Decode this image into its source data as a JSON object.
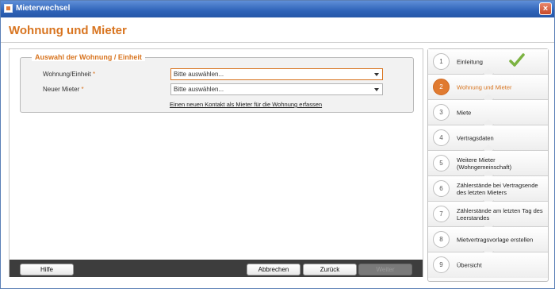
{
  "window": {
    "title": "Mieterwechsel",
    "close_glyph": "×"
  },
  "page": {
    "heading": "Wohnung und Mieter"
  },
  "form": {
    "legend": "Auswahl der Wohnung / Einheit",
    "unit": {
      "label": "Wohnung/Einheit",
      "required": "*",
      "value": "Bitte auswählen..."
    },
    "tenant": {
      "label": "Neuer Mieter",
      "required": "*",
      "value": "Bitte auswählen..."
    },
    "new_contact_link": "Einen neuen Kontakt als Mieter für die Wohnung erfassen"
  },
  "footer": {
    "help": "Hilfe",
    "cancel": "Abbrechen",
    "back": "Zurück",
    "next": "Weiter"
  },
  "steps": [
    {
      "num": "1",
      "label": "Einleitung",
      "done": true
    },
    {
      "num": "2",
      "label": "Wohnung und Mieter",
      "active": true
    },
    {
      "num": "3",
      "label": "Miete"
    },
    {
      "num": "4",
      "label": "Vertragsdaten"
    },
    {
      "num": "5",
      "label": "Weitere Mieter (Wohngemeinschaft)"
    },
    {
      "num": "6",
      "label": "Zählerstände bei Vertragsende des letzten Mieters"
    },
    {
      "num": "7",
      "label": "Zählerstände am letzten Tag des Leerstandes"
    },
    {
      "num": "8",
      "label": "Mietvertragsvorlage erstellen"
    },
    {
      "num": "9",
      "label": "Übersicht"
    }
  ],
  "colors": {
    "accent": "#d8741f",
    "active_step": "#e07a30",
    "check": "#7cb342"
  }
}
